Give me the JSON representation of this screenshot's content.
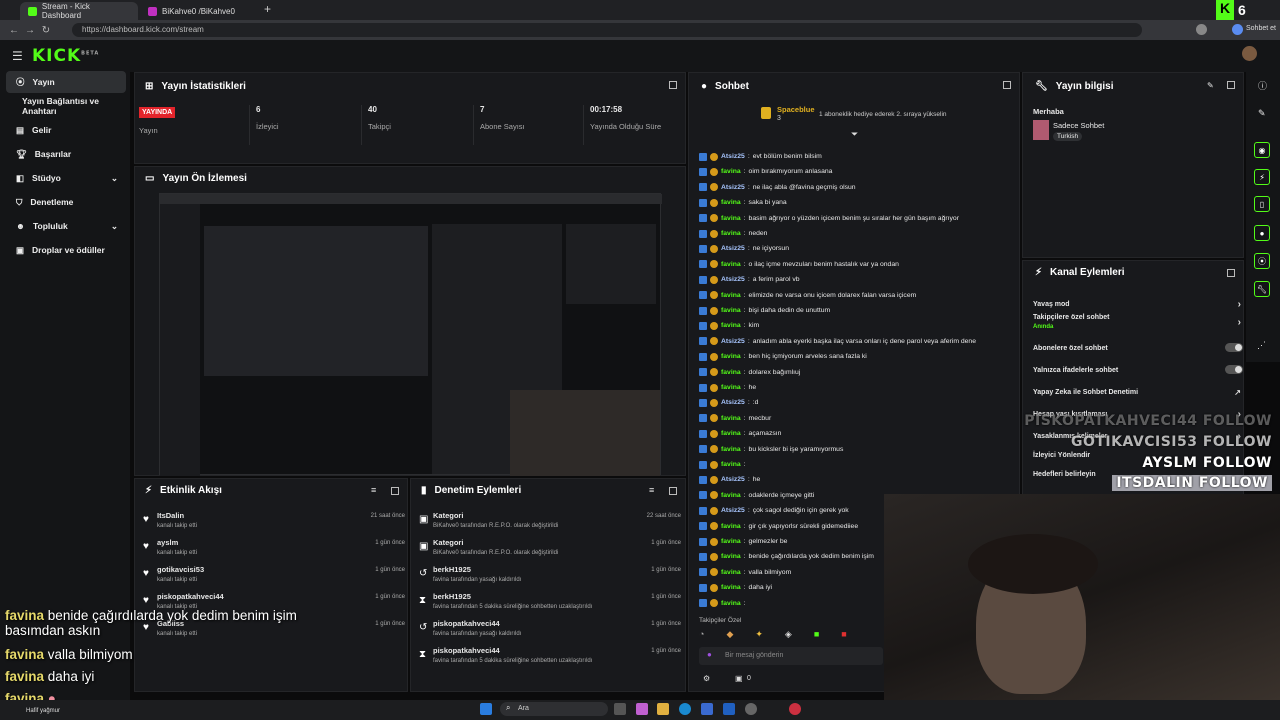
{
  "browser": {
    "tabs": [
      {
        "label": "Stream - Kick Dashboard"
      },
      {
        "label": "BiKahve0 /BiKahve0"
      }
    ],
    "url": "https://dashboard.kick.com/stream",
    "profile_label": "Sohbet et",
    "corner_badge": "6"
  },
  "kick": {
    "logo": "KICK",
    "logo_sup": "BETA"
  },
  "sidebar": {
    "items": [
      {
        "label": "Yayın"
      },
      {
        "label": "Yayın Bağlantısı ve Anahtarı"
      },
      {
        "label": "Gelir"
      },
      {
        "label": "Başarılar"
      },
      {
        "label": "Stüdyo"
      },
      {
        "label": "Denetleme"
      },
      {
        "label": "Topluluk"
      },
      {
        "label": "Droplar ve ödüller"
      }
    ]
  },
  "stats": {
    "title": "Yayın İstatistikleri",
    "live_badge": "YAYINDA",
    "items": [
      {
        "value": "",
        "label": "Yayın"
      },
      {
        "value": "6",
        "label": "İzleyici"
      },
      {
        "value": "40",
        "label": "Takipçi"
      },
      {
        "value": "7",
        "label": "Abone Sayısı"
      },
      {
        "value": "00:17:58",
        "label": "Yayında Olduğu Süre"
      }
    ]
  },
  "preview": {
    "title": "Yayın Ön İzlemesi"
  },
  "activity": {
    "title": "Etkinlik Akışı",
    "items": [
      {
        "name": "ItsDalin",
        "sub": "kanalı takip etti",
        "time": "21 saat önce"
      },
      {
        "name": "ayslm",
        "sub": "kanalı takip etti",
        "time": "1 gün önce"
      },
      {
        "name": "gotikavcisi53",
        "sub": "kanalı takip etti",
        "time": "1 gün önce"
      },
      {
        "name": "piskopatkahveci44",
        "sub": "kanalı takip etti",
        "time": "1 gün önce"
      },
      {
        "name": "Gabiiss",
        "sub": "kanalı takip etti",
        "time": "1 gün önce"
      }
    ]
  },
  "moderation": {
    "title": "Denetim Eylemleri",
    "items": [
      {
        "name": "Kategori",
        "sub": "BiKahve0 tarafından R.E.P.O. olarak değiştirildi",
        "time": "22 saat önce"
      },
      {
        "name": "Kategori",
        "sub": "BiKahve0 tarafından R.E.P.O. olarak değiştirildi",
        "time": "1 gün önce"
      },
      {
        "name": "berkH1925",
        "sub": "favina tarafından yasağı kaldırıldı",
        "time": "1 gün önce"
      },
      {
        "name": "berkH1925",
        "sub": "favina tarafından 5 dakika süreliğine sohbetten uzaklaştırıldı",
        "time": "1 gün önce"
      },
      {
        "name": "piskopatkahveci44",
        "sub": "favina tarafından yasağı kaldırıldı",
        "time": "1 gün önce"
      },
      {
        "name": "piskopatkahveci44",
        "sub": "favina tarafından 5 dakika süreliğine sohbetten uzaklaştırıldı",
        "time": "1 gün önce"
      }
    ]
  },
  "chat": {
    "title": "Sohbet",
    "pinned_name": "Spaceblue",
    "pinned_count": "3",
    "pinned_text": "1 aboneklik hediye ederek 2. sıraya yükselin",
    "messages": [
      {
        "user": "Atsiz25",
        "text": "evt bölüm benim bilsim"
      },
      {
        "user": "favina",
        "text": "oim bırakmıyorum anlasana"
      },
      {
        "user": "Atsiz25",
        "text": "ne ilaç abla @favina geçmiş olsun"
      },
      {
        "user": "favina",
        "text": "saka bi yana"
      },
      {
        "user": "favina",
        "text": "basim ağrıyor o yüzden içicem benim şu sıralar her gün başım ağrıyor"
      },
      {
        "user": "favina",
        "text": "neden"
      },
      {
        "user": "Atsiz25",
        "text": "ne içiyorsun"
      },
      {
        "user": "favina",
        "text": "o ilaç içme mevzuları benim hastalık var ya ondan"
      },
      {
        "user": "Atsiz25",
        "text": "a ferim parol vb"
      },
      {
        "user": "favina",
        "text": "elimizde ne varsa onu içicem dolarex falan varsa içicem"
      },
      {
        "user": "favina",
        "text": "bişi daha dedin de unuttum"
      },
      {
        "user": "favina",
        "text": "kim"
      },
      {
        "user": "Atsiz25",
        "text": "anladım abla eyerki başka ilaç varsa onları iç dene parol veya aferim dene"
      },
      {
        "user": "favina",
        "text": "ben hiç içmiyorum arveles sana fazla ki"
      },
      {
        "user": "favina",
        "text": "dolarex bağımlıuj"
      },
      {
        "user": "favina",
        "text": "he"
      },
      {
        "user": "Atsiz25",
        "text": ":d"
      },
      {
        "user": "favina",
        "text": "mecbur"
      },
      {
        "user": "favina",
        "text": "açamazsın"
      },
      {
        "user": "favina",
        "text": "bu kicksler bi işe yaramıyormus"
      },
      {
        "user": "favina",
        "text": ""
      },
      {
        "user": "Atsiz25",
        "text": "he"
      },
      {
        "user": "favina",
        "text": "odaklerde içmeye gitti"
      },
      {
        "user": "Atsiz25",
        "text": "çok sagol dediğin için gerek yok"
      },
      {
        "user": "favina",
        "text": "gir çık yapıyorlsr sürekli gidemediiee"
      },
      {
        "user": "favina",
        "text": "gelmezler be"
      },
      {
        "user": "favina",
        "text": "benide çağırdılarda yok dedim benim işim"
      },
      {
        "user": "favina",
        "text": "valla bilmiyom"
      },
      {
        "user": "favina",
        "text": "daha iyi"
      },
      {
        "user": "favina",
        "text": ""
      }
    ],
    "followers_only": "Takipçiler Özel",
    "input_placeholder": "Bir mesaj gönderin",
    "footer_count": "0"
  },
  "stream_info": {
    "title": "Yayın bilgisi",
    "greeting": "Merhaba",
    "stream_title": "Sadece Sohbet",
    "tag": "Turkish"
  },
  "channel_actions": {
    "title": "Kanal Eylemleri",
    "items": [
      {
        "label": "Yavaş mod",
        "control": "chevron",
        "sub": ""
      },
      {
        "label": "Takipçilere özel sohbet",
        "control": "chevron",
        "sub": "Anında"
      },
      {
        "label": "Abonelere özel sohbet",
        "control": "toggle",
        "sub": ""
      },
      {
        "label": "Yalnızca ifadelerle sohbet",
        "control": "toggle",
        "sub": ""
      },
      {
        "label": "Yapay Zeka ile Sohbet Denetimi",
        "control": "link",
        "sub": ""
      },
      {
        "label": "Hesap yaşı kısıtlaması",
        "control": "chevron",
        "sub": ""
      },
      {
        "label": "Yasaklanmış kelimeler",
        "control": "chevron",
        "sub": ""
      },
      {
        "label": "İzleyici Yönlendir",
        "control": "none",
        "sub": ""
      },
      {
        "label": "Hedefleri belirleyin",
        "control": "none",
        "sub": ""
      }
    ]
  },
  "follow_overlay": [
    {
      "name": "PISKOPATKAHVECI44",
      "word": "FOLLOW"
    },
    {
      "name": "GOTIKAVCISI53",
      "word": "FOLLOW"
    },
    {
      "name": "AYSLM",
      "word": "FOLLOW"
    },
    {
      "name": "ITSDALIN",
      "word": "FOLLOW"
    }
  ],
  "chat_overlay": [
    {
      "user": "favina",
      "text": "benide çağırdılarda yok dedim benim işim basımdan askın"
    },
    {
      "user": "favina",
      "text": "valla bilmiyom"
    },
    {
      "user": "favina",
      "text": "daha iyi"
    },
    {
      "user": "favina",
      "text": ""
    }
  ],
  "taskbar": {
    "weather": "Hafif yağmur",
    "search": "Ara"
  }
}
